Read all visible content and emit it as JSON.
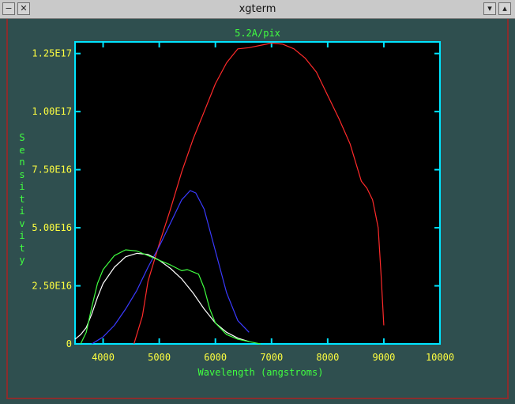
{
  "window": {
    "title": "xgterm",
    "buttons": {
      "menu": "−",
      "close": "✕",
      "minimize": "▾",
      "maximize": "▴"
    }
  },
  "colors": {
    "background": "#2f4f4f",
    "axes": "#00e5ff",
    "tick_labels": "#ffff40",
    "axis_titles": "#40ff40",
    "series_red": "#ff2a2a",
    "series_blue": "#3a3aff",
    "series_white": "#ffffff",
    "series_green": "#40ff40"
  },
  "chart_data": {
    "type": "line",
    "title": "5.2A/pix",
    "xlabel": "Wavelength (angstroms)",
    "ylabel": "Sensitivity",
    "xlim": [
      3500,
      10000
    ],
    "ylim": [
      0,
      1.3e+17
    ],
    "xticks": [
      {
        "value": 4000,
        "label": "4000"
      },
      {
        "value": 5000,
        "label": "5000"
      },
      {
        "value": 6000,
        "label": "6000"
      },
      {
        "value": 7000,
        "label": "7000"
      },
      {
        "value": 8000,
        "label": "8000"
      },
      {
        "value": 9000,
        "label": "9000"
      },
      {
        "value": 10000,
        "label": "10000"
      }
    ],
    "yticks": [
      {
        "value": 0,
        "label": "0"
      },
      {
        "value": 2.5e+16,
        "label": "2.50E16"
      },
      {
        "value": 5e+16,
        "label": "5.00E16"
      },
      {
        "value": 7.5e+16,
        "label": "7.50E16"
      },
      {
        "value": 1e+17,
        "label": "1.00E17"
      },
      {
        "value": 1.25e+17,
        "label": "1.25E17"
      }
    ],
    "series": [
      {
        "color": "#ff2a2a",
        "x": [
          4550,
          4700,
          4800,
          5000,
          5200,
          5400,
          5600,
          5800,
          6000,
          6200,
          6400,
          6600,
          6800,
          7000,
          7200,
          7400,
          7600,
          7800,
          8000,
          8200,
          8400,
          8600,
          8700,
          8800,
          8850,
          8900,
          8950,
          9000
        ],
        "y": [
          0,
          1.2e+16,
          2.7e+16,
          4.3e+16,
          5.8e+16,
          7.4e+16,
          8.8e+16,
          1e+17,
          1.12e+17,
          1.21e+17,
          1.27e+17,
          1.275e+17,
          1.285e+17,
          1.295e+17,
          1.29e+17,
          1.27e+17,
          1.23e+17,
          1.17e+17,
          1.07e+17,
          9.7e+16,
          8.6e+16,
          7e+16,
          6.7e+16,
          6.2e+16,
          5.6e+16,
          5e+16,
          3e+16,
          8000000000000000.0
        ]
      },
      {
        "color": "#3a3aff",
        "x": [
          3800,
          4000,
          4200,
          4400,
          4600,
          4800,
          5000,
          5200,
          5400,
          5550,
          5650,
          5800,
          6000,
          6200,
          6400,
          6600
        ],
        "y": [
          0,
          3000000000000000.0,
          8000000000000000.0,
          1.5e+16,
          2.3e+16,
          3.3e+16,
          4.2e+16,
          5.2e+16,
          6.2e+16,
          6.6e+16,
          6.5e+16,
          5.8e+16,
          4e+16,
          2.2e+16,
          1e+16,
          5000000000000000.0
        ]
      },
      {
        "color": "#ffffff",
        "x": [
          3500,
          3600,
          3700,
          3800,
          3900,
          4000,
          4200,
          4400,
          4600,
          4800,
          5000,
          5200,
          5400,
          5600,
          5800,
          6000,
          6200,
          6400,
          6600
        ],
        "y": [
          2000000000000000.0,
          4000000000000000.0,
          7000000000000000.0,
          1.3e+16,
          2e+16,
          2.6e+16,
          3.3e+16,
          3.75e+16,
          3.9e+16,
          3.85e+16,
          3.6e+16,
          3.25e+16,
          2.8e+16,
          2.2e+16,
          1.5e+16,
          9000000000000000.0,
          5000000000000000.0,
          2500000000000000.0,
          1000000000000000.0
        ]
      },
      {
        "color": "#40ff40",
        "x": [
          3600,
          3700,
          3800,
          3900,
          4000,
          4200,
          4400,
          4600,
          4800,
          5000,
          5200,
          5400,
          5500,
          5700,
          5800,
          5900,
          6000,
          6200,
          6400,
          6600,
          6800
        ],
        "y": [
          0,
          5000000000000000.0,
          1.6e+16,
          2.6e+16,
          3.2e+16,
          3.8e+16,
          4.05e+16,
          4e+16,
          3.8e+16,
          3.6e+16,
          3.4e+16,
          3.15e+16,
          3.2e+16,
          3e+16,
          2.4e+16,
          1.5e+16,
          9000000000000000.0,
          4000000000000000.0,
          2000000000000000.0,
          1000000000000000.0,
          0
        ]
      }
    ]
  }
}
